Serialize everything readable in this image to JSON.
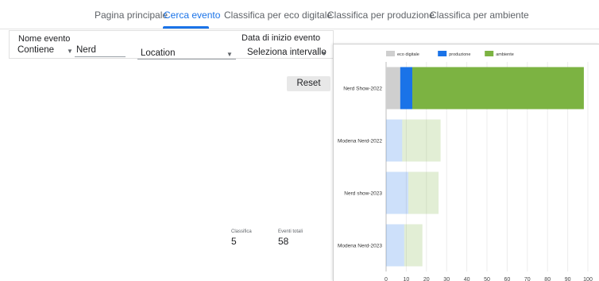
{
  "nav": {
    "tabs": [
      {
        "label": "Pagina principale"
      },
      {
        "label": "Cerca evento"
      },
      {
        "label": "Classifica per eco digitale"
      },
      {
        "label": "Classifica per produzione"
      },
      {
        "label": "Classifica per ambiente"
      }
    ],
    "active_tab": "Cerca evento"
  },
  "filters": {
    "event_name": {
      "label": "Nome evento",
      "operator": "Contiene",
      "value": "Nerd"
    },
    "location": {
      "value": "Location"
    },
    "start_date": {
      "label": "Data di inizio evento",
      "value": "Seleziona intervallo"
    },
    "reset_label": "Reset"
  },
  "scorecards": [
    {
      "label": "Classifica",
      "value": "5"
    },
    {
      "label": "Eventi totali",
      "value": "58"
    }
  ],
  "colors": {
    "accent": "#1a73e8",
    "eco_digitale": "#cfcfcf",
    "produzione": "#1a73e8",
    "ambiente": "#7cb342"
  },
  "chart_data": {
    "type": "bar",
    "orientation": "horizontal",
    "stacked": true,
    "categories": [
      "Nerd Show-2022",
      "Modena Nerd-2022",
      "Nerd show-2023",
      "Modena Nerd-2023"
    ],
    "highlighted_category": "Nerd Show-2022",
    "series": [
      {
        "name": "eco digitale",
        "values": [
          7,
          0,
          0,
          0
        ]
      },
      {
        "name": "produzione",
        "values": [
          6,
          8,
          11,
          9
        ]
      },
      {
        "name": "ambiente",
        "values": [
          85,
          19,
          15,
          9
        ]
      }
    ],
    "x_ticks": [
      "0",
      "10",
      "20",
      "30",
      "40",
      "50",
      "60",
      "70",
      "80",
      "90",
      "100"
    ],
    "xlim": [
      0,
      100
    ],
    "grid": true,
    "legend_position": "top"
  }
}
